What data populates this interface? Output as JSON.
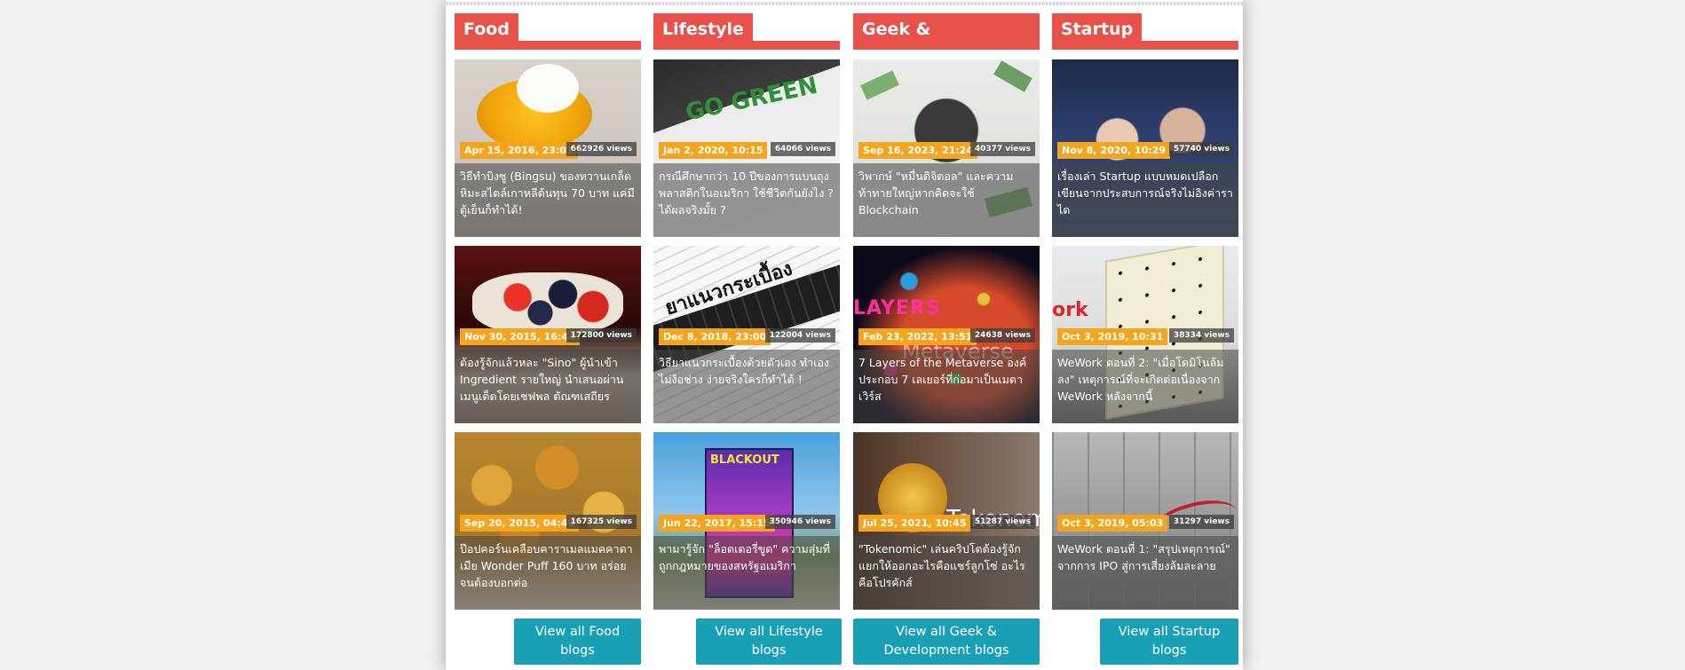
{
  "columns": [
    {
      "title": "Food",
      "button": "View all Food blogs",
      "cards": [
        {
          "date": "Apr 15, 2016, 23:03",
          "views": "662926 views",
          "title": "วิธีทำบิงซู (Bingsu) ของหวานเกล็ดหิมะสไตล์เกาหลีต้นทุน 70 บาท แค่มีตู้เย็นก็ทำได้!"
        },
        {
          "date": "Nov 30, 2015, 16:44",
          "views": "172800 views",
          "title": "ต้องรู้จักแล้วหละ \"Sino\" ผู้นำเข้า Ingredient รายใหญ่ นำเสนอผ่านเมนูเด็ดโดยเชฟพล ตัณฑเสถียร"
        },
        {
          "date": "Sep 20, 2015, 04:46",
          "views": "167325 views",
          "title": "ป๊อปคอร์นเคลือบคาราเมลแมคคาดาเมีย Wonder Puff 160 บาท อร่อยจนต้องบอกต่อ"
        }
      ]
    },
    {
      "title": "Lifestyle",
      "button": "View all Lifestyle blogs",
      "cards": [
        {
          "date": "Jan 2, 2020, 10:15",
          "views": "64066 views",
          "title": "กรณีศึกษากว่า 10 ปีของการแบนถุงพลาสติกในอเมริกา ใช้ชีวิตกันยังไง ? ได้ผลจริงมั้ย ?"
        },
        {
          "date": "Dec 8, 2018, 23:00",
          "views": "122004 views",
          "title": "วิธียาแนวกระเบื้องด้วยตัวเอง ทำเองไม่ง้อช่าง ง่ายจริงใครก็ทำได้ !"
        },
        {
          "date": "Jun 22, 2017, 15:15",
          "views": "350946 views",
          "title": "พามารู้จัก \"ล็อตเตอรี่ขูด\" ความสุ่มที่ถูกกฎหมายของสหรัฐอเมริกา"
        }
      ]
    },
    {
      "title": "Geek & Development",
      "button": "View all Geek & Development blogs",
      "cards": [
        {
          "date": "Sep 16, 2023, 21:24",
          "views": "40377 views",
          "title": "วิพากษ์ \"หมื่นดิจิตอล\" และความท้าทายใหญ่หากคิดจะใช้ Blockchain"
        },
        {
          "date": "Feb 23, 2022, 13:51",
          "views": "24638 views",
          "title": "7 Layers of the Metaverse องค์ประกอบ 7 เลเยอร์ที่ก่อมาเป็นเมตาเวิร์ส"
        },
        {
          "date": "Jul 25, 2021, 10:45",
          "views": "51287 views",
          "title": "\"Tokenomic\" เล่นคริปโตต้องรู้จัก แยกให้ออกอะไรคือแชร์ลูกโซ่ อะไรคือโปรคักส์"
        }
      ]
    },
    {
      "title": "Startup",
      "button": "View all Startup blogs",
      "cards": [
        {
          "date": "Nov 8, 2020, 10:29",
          "views": "57740 views",
          "title": "เรื่องเล่า Startup แบบหมดเปลือก เขียนจากประสบการณ์จริงไม่อิงค่าราได"
        },
        {
          "date": "Oct 3, 2019, 10:31",
          "views": "38334 views",
          "title": "WeWork ตอนที่ 2: \"เมื่อโดมิโนล้มลง\" เหตุการณ์ที่จะเกิดต่อเนื่องจาก WeWork หลังจากนี้"
        },
        {
          "date": "Oct 3, 2019, 05:03",
          "views": "31297 views",
          "title": "WeWork ตอนที่ 1: \"สรุปเหตุการณ์\" จากการ IPO สู่การเสี่ยงล้มละลาย"
        }
      ]
    }
  ],
  "image_text": {
    "gogreen": "GO GREEN",
    "tile": "ยาแนวกระเบื้อง",
    "layers": "LAYERS",
    "metaverse": "Metaverse",
    "blackout": "BLACKOUT",
    "tokenomic": "Tokenomic",
    "work": "ork"
  }
}
